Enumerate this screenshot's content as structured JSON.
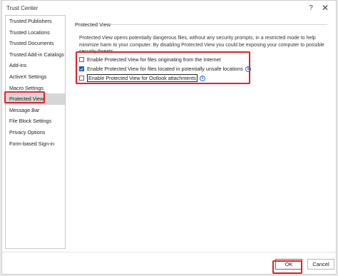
{
  "window": {
    "title": "Trust Center",
    "help_glyph": "?",
    "close_glyph": "✕"
  },
  "sidebar": {
    "items": [
      {
        "label": "Trusted Publishers"
      },
      {
        "label": "Trusted Locations"
      },
      {
        "label": "Trusted Documents"
      },
      {
        "label": "Trusted Add-in Catalogs"
      },
      {
        "label": "Add-ins"
      },
      {
        "label": "ActiveX Settings"
      },
      {
        "label": "Macro Settings"
      },
      {
        "label": "Protected View",
        "selected": true
      },
      {
        "label": "Message Bar"
      },
      {
        "label": "File Block Settings"
      },
      {
        "label": "Privacy Options"
      },
      {
        "label": "Form-based Sign-in"
      }
    ]
  },
  "main": {
    "section_title": "Protected View",
    "description": "Protected View opens potentially dangerous files, without any security prompts, in a restricted mode to help minimize harm to your computer. By disabling Protected View you could be exposing your computer to possible security threats.",
    "options": [
      {
        "label": "Enable Protected View for files originating from the Internet",
        "checked": false,
        "info": false
      },
      {
        "label": "Enable Protected View for files located in potentially unsafe locations",
        "checked": true,
        "info": true
      },
      {
        "label": "Enable Protected View for Outlook attachments",
        "checked": false,
        "info": true,
        "focused": true
      }
    ],
    "info_glyph": "i"
  },
  "footer": {
    "ok_label": "OK",
    "cancel_label": "Cancel"
  },
  "colors": {
    "highlight": "#e0202a",
    "checkbox_checked": "#1f5fbf",
    "info_icon": "#2b6fd6",
    "selected_item_bg": "#d6d6d6"
  }
}
